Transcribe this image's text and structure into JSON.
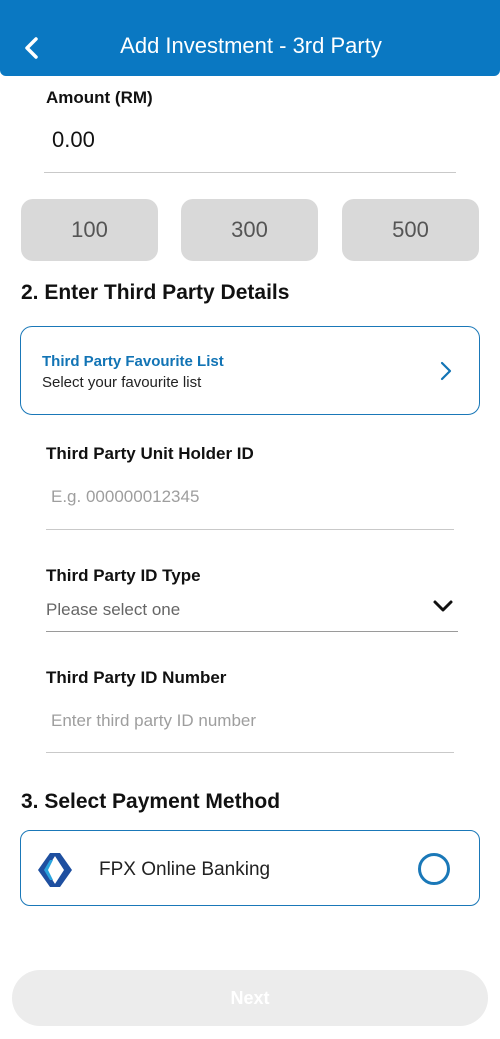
{
  "header": {
    "title": "Add Investment - 3rd Party",
    "back_icon": "chevron-left-icon",
    "background": "#0a78c2"
  },
  "amount": {
    "label": "Amount (RM)",
    "value": "0.00",
    "quick_amounts": [
      "100",
      "300",
      "500"
    ]
  },
  "section2": {
    "title": "2. Enter Third Party Details",
    "favourite": {
      "title": "Third Party Favourite List",
      "subtitle": "Select your favourite list",
      "icon": "chevron-right-icon"
    },
    "unit_holder": {
      "label": "Third Party Unit Holder ID",
      "placeholder": "E.g. 000000012345"
    },
    "id_type": {
      "label": "Third Party ID Type",
      "placeholder": "Please select one",
      "icon": "chevron-down-icon"
    },
    "id_number": {
      "label": "Third Party ID Number",
      "placeholder": "Enter third party ID number"
    }
  },
  "section3": {
    "title": "3. Select Payment Method",
    "methods": [
      {
        "label": "FPX Online Banking",
        "icon": "fpx-logo-icon",
        "selected": false
      }
    ]
  },
  "footer": {
    "next_label": "Next",
    "enabled": false
  },
  "colors": {
    "accent": "#1a78b8",
    "disabled_button": "#ececec"
  }
}
